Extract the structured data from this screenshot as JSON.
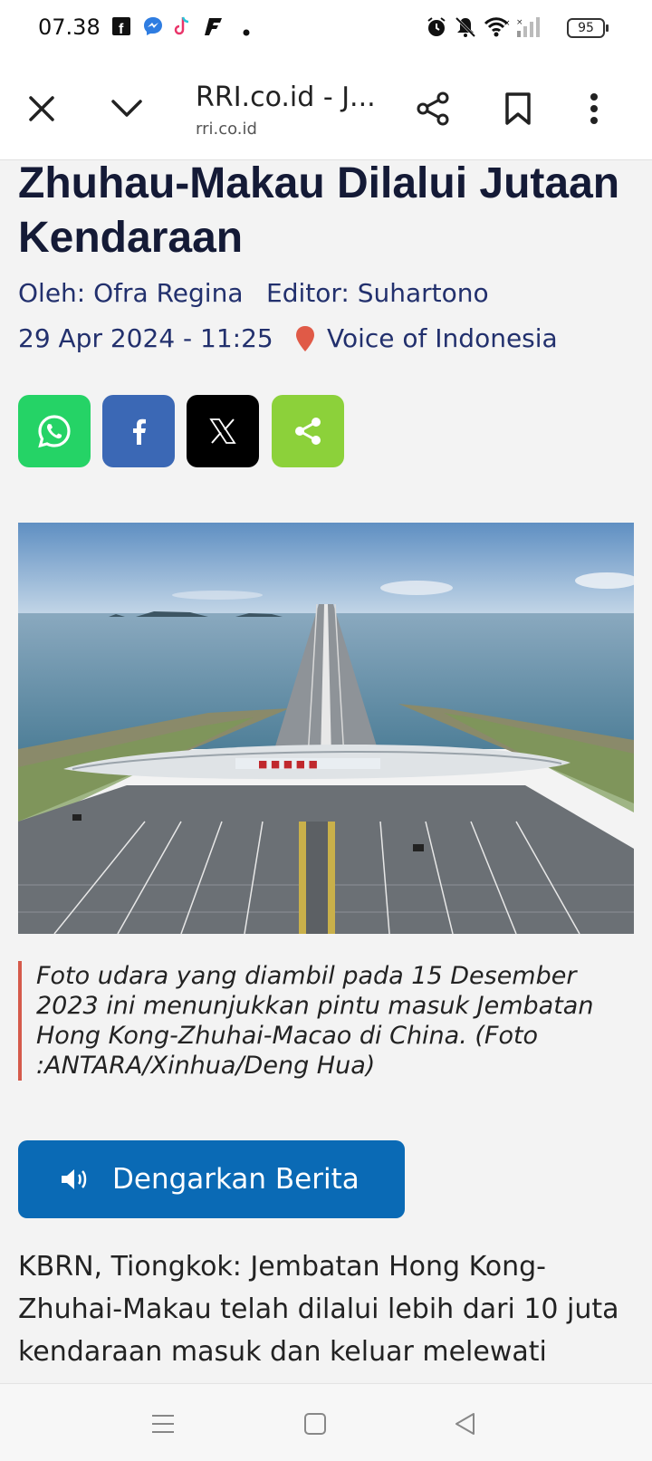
{
  "status_bar": {
    "time": "07.38",
    "battery": "95",
    "icons": [
      "facebook-icon",
      "messenger-icon",
      "tiktok-icon",
      "app-f-icon",
      "dot-icon",
      "alarm-icon",
      "mute-icon",
      "wifi-icon",
      "signal-icon",
      "battery-icon"
    ]
  },
  "toolbar": {
    "title": "RRI.co.id - J...",
    "subtitle": "rri.co.id",
    "icons": [
      "close-icon",
      "chevron-down-icon",
      "share-icon",
      "bookmark-icon",
      "more-vert-icon"
    ]
  },
  "article": {
    "headline": "Zhuhau-Makau Dilalui Jutaan Kendaraan",
    "author": "Oleh: Ofra Regina",
    "editor": "Editor: Suhartono",
    "date": "29 Apr 2024 - 11:25",
    "location": "Voice of Indonesia",
    "share_buttons": [
      {
        "name": "whatsapp",
        "color": "#25d366"
      },
      {
        "name": "facebook",
        "color": "#3b68b5"
      },
      {
        "name": "x",
        "color": "#000000"
      },
      {
        "name": "share",
        "color": "#8cd13a"
      }
    ],
    "caption": "Foto udara yang diambil pada 15 Desember 2023 ini menunjukkan pintu masuk Jembatan Hong Kong-Zhuhai-Macao di China. (Foto :ANTARA/Xinhua/Deng Hua)",
    "listen_label": "Dengarkan Berita",
    "body": "KBRN, Tiongkok: Jembatan Hong Kong-Zhuhai-Makau telah dilalui lebih dari 10 juta kendaraan masuk dan keluar melewati"
  },
  "colors": {
    "headline": "#141a36",
    "meta": "#22306d",
    "pin": "#e05a47",
    "listen_button": "#0a6ab5",
    "caption_border": "#d55a4b"
  }
}
